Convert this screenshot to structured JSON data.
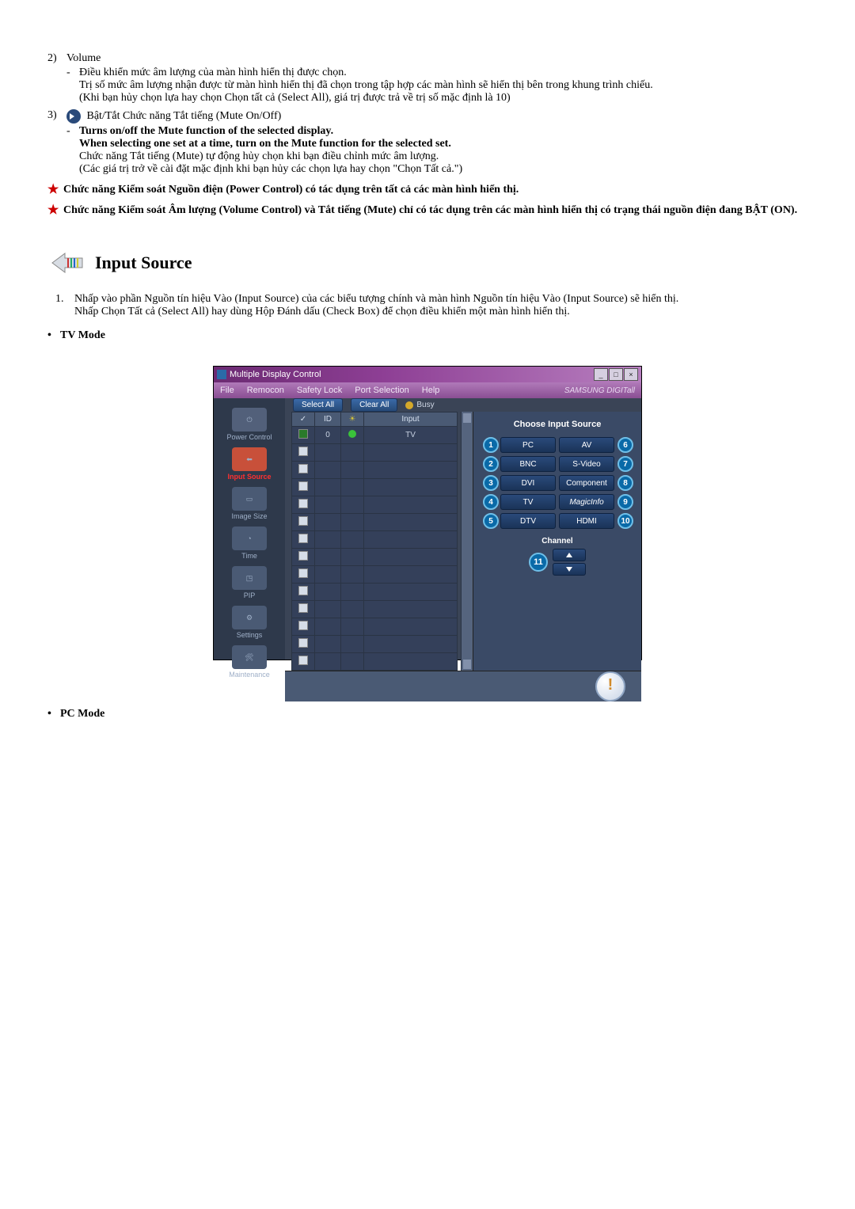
{
  "list2": {
    "num": "2)",
    "title": "Volume",
    "d1": "Điều khiển mức âm lượng của màn hình hiển thị được chọn.",
    "d1a": "Trị số mức âm lượng nhận được từ màn hình hiển thị đã chọn trong tập hợp các màn hình sẽ hiển thị bên trong khung trình chiếu.",
    "d1b": "(Khi bạn hủy chọn lựa hay chọn Chọn tất cả (Select All), giá trị được trả về trị số mặc định là 10)"
  },
  "list3": {
    "num": "3)",
    "title": "Bật/Tắt Chức năng Tắt tiếng (Mute On/Off)",
    "d1": "Turns on/off the Mute function of the selected display.",
    "d2": "When selecting one set at a time, turn on the Mute function for the selected set.",
    "d3": "Chức năng Tắt tiếng (Mute) tự động hủy chọn khi bạn điều chỉnh mức âm lượng.",
    "d4": "(Các giá trị trở về cài đặt mặc định khi bạn hủy các chọn lựa hay chọn \"Chọn Tất cả.\")"
  },
  "star1": "Chức năng Kiểm soát Nguồn điện (Power Control) có tác dụng trên tất cả các màn hình hiển thị.",
  "star2": "Chức năng Kiểm soát Âm lượng (Volume Control) và Tắt tiếng (Mute) chỉ có tác dụng trên các màn hình hiển thị có trạng thái nguồn điện đang BẬT (ON).",
  "section_title": "Input Source",
  "ordered1_num": "1.",
  "ordered1_a": "Nhấp vào phần Nguồn tín hiệu Vào (Input Source) của các biểu tượng chính và màn hình Nguồn tín hiệu Vào (Input Source) sẽ hiển thị.",
  "ordered1_b": "Nhấp Chọn Tất cả (Select All) hay dùng Hộp Đánh dấu (Check Box) để chọn điều khiển một màn hình hiển thị.",
  "tv_mode": "TV Mode",
  "pc_mode": "PC Mode",
  "app": {
    "title": "Multiple Display Control",
    "menu": {
      "file": "File",
      "remocon": "Remocon",
      "safety": "Safety Lock",
      "port": "Port Selection",
      "help": "Help",
      "brand": "SAMSUNG DIGITall"
    },
    "sidebar": {
      "power": "Power Control",
      "input": "Input Source",
      "image": "Image Size",
      "time": "Time",
      "pip": "PIP",
      "settings": "Settings",
      "maint": "Maintenance"
    },
    "toolbar": {
      "select": "Select All",
      "clear": "Clear All",
      "busy": "Busy"
    },
    "table": {
      "h_chk": "✓",
      "h_id": "ID",
      "h_status": "",
      "h_input": "Input",
      "row0": {
        "id": "0",
        "input": "TV"
      }
    },
    "panel": {
      "title": "Choose Input Source",
      "pc": "PC",
      "bnc": "BNC",
      "dvi": "DVI",
      "tv": "TV",
      "dtv": "DTV",
      "av": "AV",
      "svideo": "S-Video",
      "component": "Component",
      "magicinfo": "MagicInfo",
      "hdmi": "HDMI",
      "channel": "Channel",
      "n1": "1",
      "n2": "2",
      "n3": "3",
      "n4": "4",
      "n5": "5",
      "n6": "6",
      "n7": "7",
      "n8": "8",
      "n9": "9",
      "n10": "10",
      "n11": "11"
    }
  }
}
